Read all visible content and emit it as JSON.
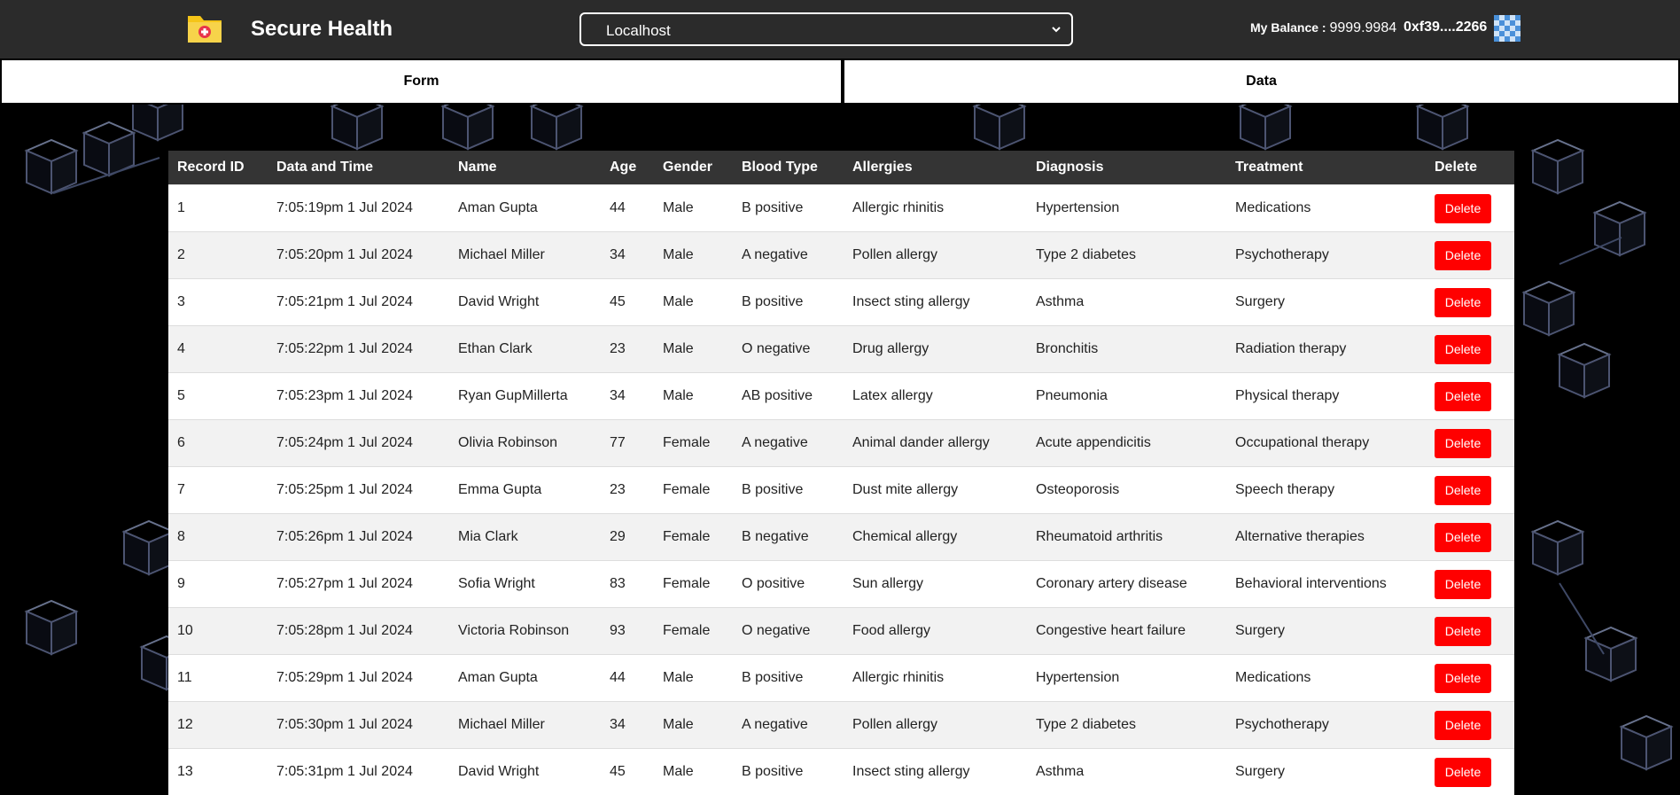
{
  "header": {
    "app_title": "Secure Health",
    "network": "Localhost",
    "balance_label": "My Balance : ",
    "balance_value": "9999.9984",
    "account": "0xf39....2266"
  },
  "tabs": [
    {
      "label": "Form"
    },
    {
      "label": "Data"
    }
  ],
  "table": {
    "columns": [
      "Record ID",
      "Data and Time",
      "Name",
      "Age",
      "Gender",
      "Blood Type",
      "Allergies",
      "Diagnosis",
      "Treatment",
      "Delete"
    ],
    "delete_label": "Delete",
    "rows": [
      {
        "id": "1",
        "datetime": "7:05:19pm 1 Jul 2024",
        "name": "Aman Gupta",
        "age": "44",
        "gender": "Male",
        "blood": "B positive",
        "allergies": "Allergic rhinitis",
        "diagnosis": "Hypertension",
        "treatment": "Medications"
      },
      {
        "id": "2",
        "datetime": "7:05:20pm 1 Jul 2024",
        "name": "Michael Miller",
        "age": "34",
        "gender": "Male",
        "blood": "A negative",
        "allergies": "Pollen allergy",
        "diagnosis": "Type 2 diabetes",
        "treatment": "Psychotherapy"
      },
      {
        "id": "3",
        "datetime": "7:05:21pm 1 Jul 2024",
        "name": "David Wright",
        "age": "45",
        "gender": "Male",
        "blood": "B positive",
        "allergies": "Insect sting allergy",
        "diagnosis": "Asthma",
        "treatment": "Surgery"
      },
      {
        "id": "4",
        "datetime": "7:05:22pm 1 Jul 2024",
        "name": "Ethan Clark",
        "age": "23",
        "gender": "Male",
        "blood": "O negative",
        "allergies": "Drug allergy",
        "diagnosis": "Bronchitis",
        "treatment": "Radiation therapy"
      },
      {
        "id": "5",
        "datetime": "7:05:23pm 1 Jul 2024",
        "name": "Ryan GupMillerta",
        "age": "34",
        "gender": "Male",
        "blood": "AB positive",
        "allergies": "Latex allergy",
        "diagnosis": "Pneumonia",
        "treatment": "Physical therapy"
      },
      {
        "id": "6",
        "datetime": "7:05:24pm 1 Jul 2024",
        "name": "Olivia Robinson",
        "age": "77",
        "gender": "Female",
        "blood": "A negative",
        "allergies": "Animal dander allergy",
        "diagnosis": "Acute appendicitis",
        "treatment": "Occupational therapy"
      },
      {
        "id": "7",
        "datetime": "7:05:25pm 1 Jul 2024",
        "name": "Emma Gupta",
        "age": "23",
        "gender": "Female",
        "blood": "B positive",
        "allergies": "Dust mite allergy",
        "diagnosis": "Osteoporosis",
        "treatment": "Speech therapy"
      },
      {
        "id": "8",
        "datetime": "7:05:26pm 1 Jul 2024",
        "name": "Mia Clark",
        "age": "29",
        "gender": "Female",
        "blood": "B negative",
        "allergies": "Chemical allergy",
        "diagnosis": "Rheumatoid arthritis",
        "treatment": "Alternative therapies"
      },
      {
        "id": "9",
        "datetime": "7:05:27pm 1 Jul 2024",
        "name": "Sofia Wright",
        "age": "83",
        "gender": "Female",
        "blood": "O positive",
        "allergies": "Sun allergy",
        "diagnosis": "Coronary artery disease",
        "treatment": "Behavioral interventions"
      },
      {
        "id": "10",
        "datetime": "7:05:28pm 1 Jul 2024",
        "name": "Victoria Robinson",
        "age": "93",
        "gender": "Female",
        "blood": "O negative",
        "allergies": "Food allergy",
        "diagnosis": "Congestive heart failure",
        "treatment": "Surgery"
      },
      {
        "id": "11",
        "datetime": "7:05:29pm 1 Jul 2024",
        "name": "Aman Gupta",
        "age": "44",
        "gender": "Male",
        "blood": "B positive",
        "allergies": "Allergic rhinitis",
        "diagnosis": "Hypertension",
        "treatment": "Medications"
      },
      {
        "id": "12",
        "datetime": "7:05:30pm 1 Jul 2024",
        "name": "Michael Miller",
        "age": "34",
        "gender": "Male",
        "blood": "A negative",
        "allergies": "Pollen allergy",
        "diagnosis": "Type 2 diabetes",
        "treatment": "Psychotherapy"
      },
      {
        "id": "13",
        "datetime": "7:05:31pm 1 Jul 2024",
        "name": "David Wright",
        "age": "45",
        "gender": "Male",
        "blood": "B positive",
        "allergies": "Insect sting allergy",
        "diagnosis": "Asthma",
        "treatment": "Surgery"
      }
    ]
  },
  "colors": {
    "header_bg": "#2b2b2b",
    "table_header_bg": "#343434",
    "delete_button": "#ff0000",
    "folder_icon": "#f5c518",
    "identicon": "#4a90d9"
  }
}
